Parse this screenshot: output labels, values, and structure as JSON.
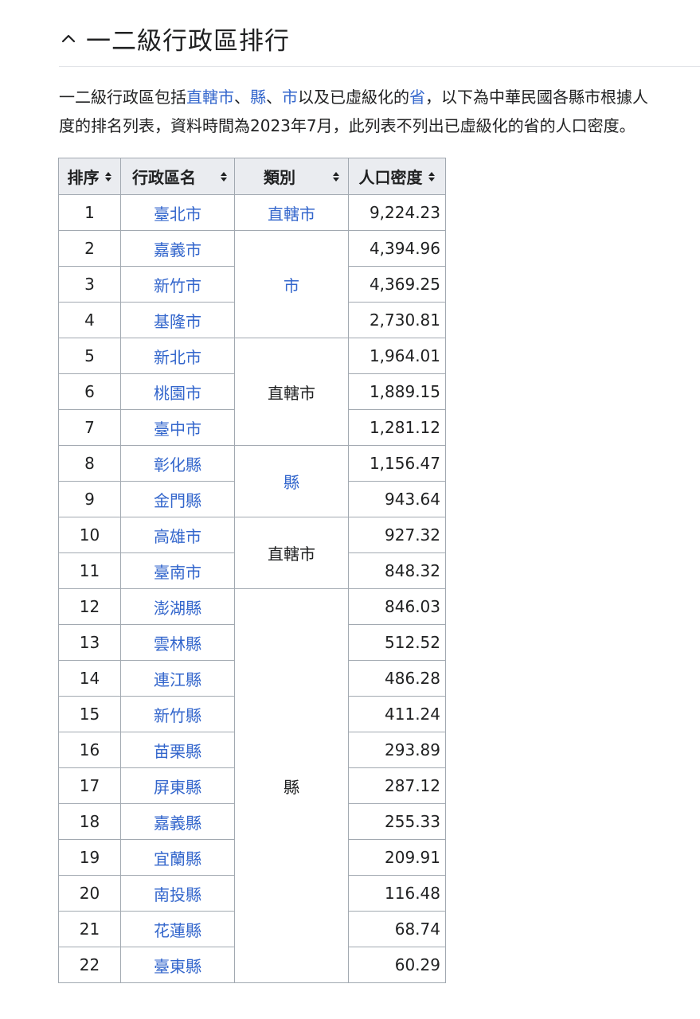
{
  "section": {
    "title": "一二級行政區排行"
  },
  "intro": {
    "line1": {
      "t1": "一二級行政區包括",
      "l1": "直轄市",
      "t2": "、",
      "l2": "縣",
      "t3": "、",
      "l3": "市",
      "t4": "以及已虛級化的",
      "l4": "省",
      "t5": "，以下為中華民國各縣市根據人"
    },
    "line2": "度的排名列表，資料時間為2023年7月，此列表不列出已虛級化的省的人口密度。"
  },
  "table": {
    "headers": {
      "rank": "排序",
      "name": "行政區名",
      "type": "類別",
      "density": "人口密度"
    },
    "rows": [
      {
        "rank": "1",
        "name": "臺北市",
        "density": "9,224.23"
      },
      {
        "rank": "2",
        "name": "嘉義市",
        "density": "4,394.96"
      },
      {
        "rank": "3",
        "name": "新竹市",
        "density": "4,369.25"
      },
      {
        "rank": "4",
        "name": "基隆市",
        "density": "2,730.81"
      },
      {
        "rank": "5",
        "name": "新北市",
        "density": "1,964.01"
      },
      {
        "rank": "6",
        "name": "桃園市",
        "density": "1,889.15"
      },
      {
        "rank": "7",
        "name": "臺中市",
        "density": "1,281.12"
      },
      {
        "rank": "8",
        "name": "彰化縣",
        "density": "1,156.47"
      },
      {
        "rank": "9",
        "name": "金門縣",
        "density": "943.64"
      },
      {
        "rank": "10",
        "name": "高雄市",
        "density": "927.32"
      },
      {
        "rank": "11",
        "name": "臺南市",
        "density": "848.32"
      },
      {
        "rank": "12",
        "name": "澎湖縣",
        "density": "846.03"
      },
      {
        "rank": "13",
        "name": "雲林縣",
        "density": "512.52"
      },
      {
        "rank": "14",
        "name": "連江縣",
        "density": "486.28"
      },
      {
        "rank": "15",
        "name": "新竹縣",
        "density": "411.24"
      },
      {
        "rank": "16",
        "name": "苗栗縣",
        "density": "293.89"
      },
      {
        "rank": "17",
        "name": "屏東縣",
        "density": "287.12"
      },
      {
        "rank": "18",
        "name": "嘉義縣",
        "density": "255.33"
      },
      {
        "rank": "19",
        "name": "宜蘭縣",
        "density": "209.91"
      },
      {
        "rank": "20",
        "name": "南投縣",
        "density": "116.48"
      },
      {
        "rank": "21",
        "name": "花蓮縣",
        "density": "68.74"
      },
      {
        "rank": "22",
        "name": "臺東縣",
        "density": "60.29"
      }
    ],
    "types": [
      {
        "label": "直轄市",
        "link": true
      },
      {
        "label": "市",
        "link": true
      },
      {
        "label": "直轄市",
        "link": false
      },
      {
        "label": "縣",
        "link": true
      },
      {
        "label": "直轄市",
        "link": false
      },
      {
        "label": "縣",
        "link": false
      }
    ]
  },
  "colors": {
    "link": "#3366cc",
    "header_bg": "#eaecf0",
    "border": "#a2a9b1"
  },
  "icons": {
    "collapse": "chevron-up-icon",
    "sort": "sort-icon"
  }
}
